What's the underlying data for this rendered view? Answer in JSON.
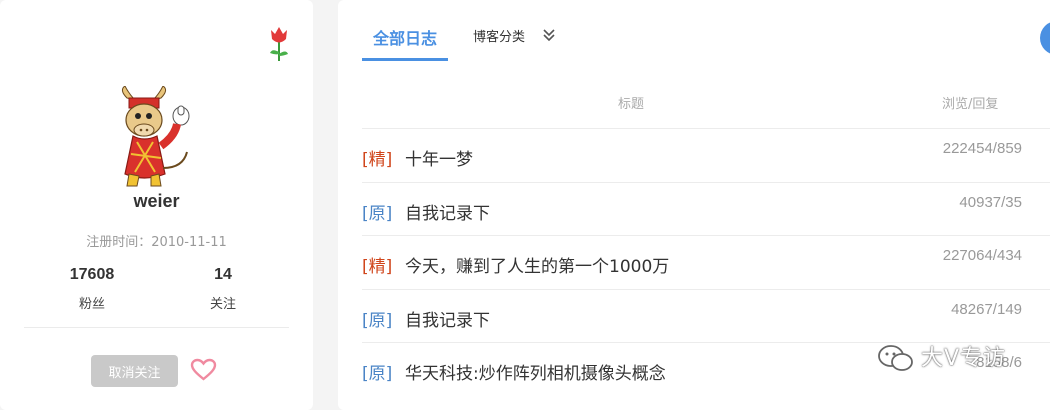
{
  "profile": {
    "username": "weier",
    "register_time": "注册时间：2010-11-11",
    "stats": [
      {
        "value": "17608",
        "label": "粉丝"
      },
      {
        "value": "14",
        "label": "关注"
      }
    ],
    "unfollow_label": "取消关注"
  },
  "tabs": {
    "all_label": "全部日志",
    "category_label": "博客分类"
  },
  "table": {
    "col_title": "标题",
    "col_views": "浏览/回复",
    "rows": [
      {
        "tag": "[精]",
        "tag_type": "featured",
        "title": "十年一梦",
        "views": "222454/859"
      },
      {
        "tag": "[原]",
        "tag_type": "original",
        "title": "自我记录下",
        "views": "40937/35"
      },
      {
        "tag": "[精]",
        "tag_type": "featured",
        "title": "今天，赚到了人生的第一个1000万",
        "views": "227064/434"
      },
      {
        "tag": "[原]",
        "tag_type": "original",
        "title": "自我记录下",
        "views": "48267/149"
      },
      {
        "tag": "[原]",
        "tag_type": "original",
        "title": "华天科技:炒作阵列相机摄像头概念",
        "views": "8158/6"
      }
    ]
  },
  "watermark": {
    "text": "大V专访"
  },
  "colors": {
    "accent_blue": "#4a90e2",
    "featured_red": "#d0451b",
    "original_blue": "#4a84c6",
    "button_gray": "#c9c9c9"
  }
}
